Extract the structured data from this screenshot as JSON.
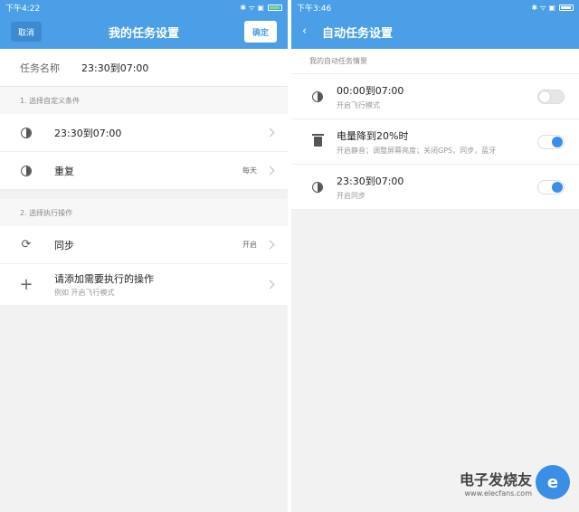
{
  "left": {
    "status": {
      "time": "下午4:22",
      "icons": "✱ ᯤ ▣"
    },
    "header": {
      "cancel": "取消",
      "title": "我的任务设置",
      "confirm": "确定"
    },
    "task_name": {
      "label": "任务名称",
      "value": "23:30到07:00"
    },
    "section1": "1. 选择自定义条件",
    "conditions": [
      {
        "label": "23:30到07:00",
        "value": ""
      },
      {
        "label": "重复",
        "value": "每天"
      }
    ],
    "section2": "2. 选择执行操作",
    "actions": [
      {
        "label": "同步",
        "value": "开启"
      },
      {
        "label": "请添加需要执行的操作",
        "sub": "例如 开启飞行模式"
      }
    ]
  },
  "right": {
    "status": {
      "time": "下午3:46",
      "icons": "✱ ᯤ ▣"
    },
    "header": {
      "title": "自动任务设置"
    },
    "section": "我的自动任务情景",
    "items": [
      {
        "label": "00:00到07:00",
        "sub": "开启飞行模式",
        "on": false,
        "icon": "moon-icon"
      },
      {
        "label": "电量降到20%时",
        "sub": "开启静音；调整屏幕亮度；关闭GPS，同步，蓝牙",
        "on": true,
        "icon": "battery-trash-icon"
      },
      {
        "label": "23:30到07:00",
        "sub": "开启同步",
        "on": true,
        "icon": "moon-icon"
      }
    ]
  },
  "watermark": {
    "cn": "电子发烧友",
    "url": "www.elecfans.com",
    "logo_char": "e"
  },
  "colors": {
    "primary": "#4a9fe6",
    "toggle_on": "#3a8ee6"
  }
}
